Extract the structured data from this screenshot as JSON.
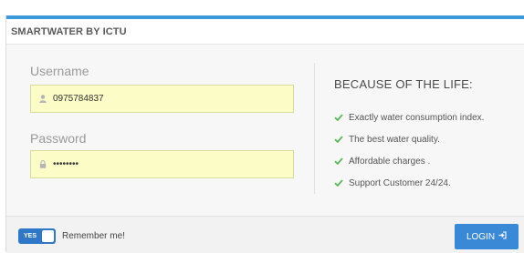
{
  "colors": {
    "accent": "#3a9ad9",
    "input_bg": "#fbfcc6",
    "check": "#5cb85c",
    "button": "#3a89d6"
  },
  "header": {
    "title": "SMARTWATER BY ICTU"
  },
  "form": {
    "username_label": "Username",
    "username_value": "0975784837",
    "username_icon": "user-icon",
    "password_label": "Password",
    "password_value": "••••••••",
    "password_icon": "lock-icon"
  },
  "info": {
    "headline": "BECAUSE OF THE LIFE:",
    "features": [
      "Exactly water consumption index.",
      "The best water quality.",
      "Affordable charges .",
      "Support Customer 24/24."
    ]
  },
  "footer": {
    "toggle_label": "YES",
    "remember_label": "Remember me!",
    "login_label": "LOGIN",
    "login_icon": "sign-in-icon"
  }
}
